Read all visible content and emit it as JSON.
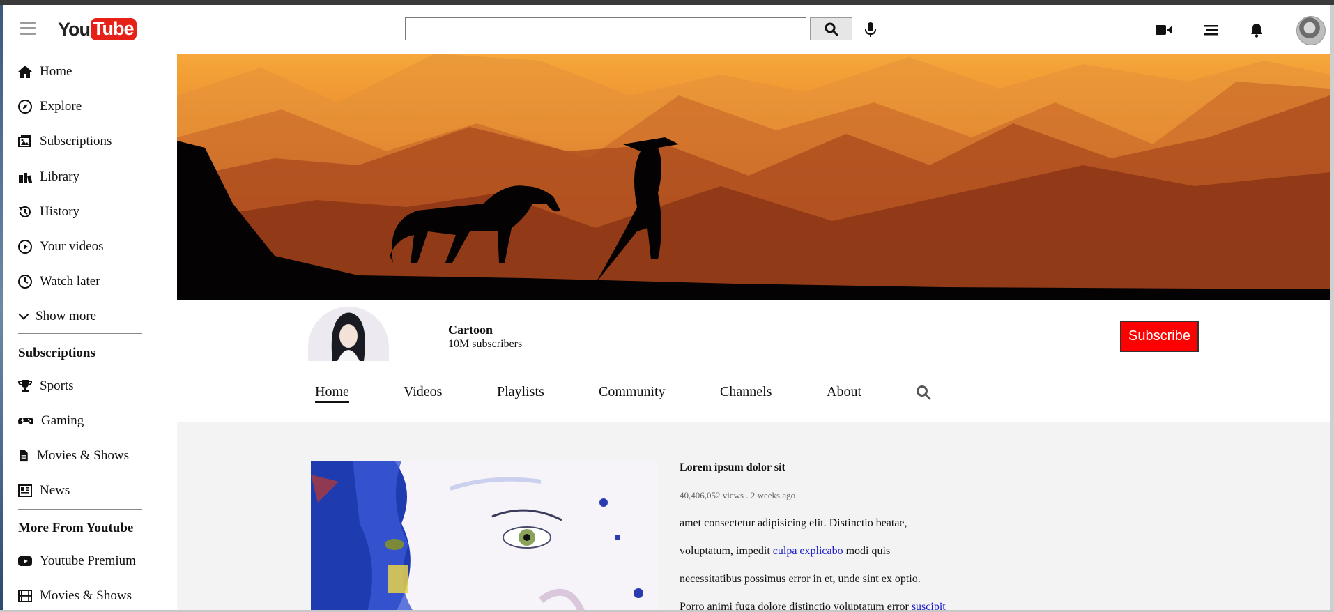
{
  "header": {
    "logo_you": "You",
    "logo_tube": "Tube",
    "search_placeholder": "",
    "icons": [
      "hamburger-icon",
      "search-icon",
      "mic-icon",
      "video-camera-icon",
      "apps-list-icon",
      "bell-icon"
    ]
  },
  "sidebar": {
    "items": [
      {
        "label": "Home",
        "icon": "home-icon"
      },
      {
        "label": "Explore",
        "icon": "compass-icon"
      },
      {
        "label": "Subscriptions",
        "icon": "subscriptions-icon"
      },
      {
        "label": "Library",
        "icon": "library-icon"
      },
      {
        "label": "History",
        "icon": "history-icon"
      },
      {
        "label": "Your videos",
        "icon": "play-circle-icon"
      },
      {
        "label": "Watch later",
        "icon": "clock-icon"
      },
      {
        "label": "Show more",
        "icon": "chevron-down-icon"
      }
    ],
    "subscriptions_heading": "Subscriptions",
    "subscriptions": [
      {
        "label": "Sports",
        "icon": "trophy-icon"
      },
      {
        "label": "Gaming",
        "icon": "gamepad-icon"
      },
      {
        "label": "Movies & Shows",
        "icon": "file-icon"
      },
      {
        "label": "News",
        "icon": "newspaper-icon"
      }
    ],
    "more_heading": "More From Youtube",
    "more": [
      {
        "label": "Youtube Premium",
        "icon": "youtube-icon"
      },
      {
        "label": "Movies & Shows",
        "icon": "film-icon"
      }
    ]
  },
  "channel": {
    "name": "Cartoon",
    "subscribers": "10M subscribers",
    "subscribe_label": "Subscribe",
    "tabs": [
      "Home",
      "Videos",
      "Playlists",
      "Community",
      "Channels",
      "About"
    ],
    "active_tab": "Home"
  },
  "video": {
    "title": "Lorem ipsum dolor sit",
    "meta": "40,406,052 views . 2 weeks ago",
    "line1": "amet consectetur adipisicing elit. Distinctio beatae,",
    "line2_pre": "voluptatum, impedit ",
    "line2_link": "culpa explicabo",
    "line2_post": " modi quis",
    "line3": "necessitatibus possimus error in et, unde sint ex optio.",
    "line4_pre": "Porro animi fuga dolore distinctio voluptatum error ",
    "line4_link": "suscipit"
  },
  "colors": {
    "brand_red": "#ff0000",
    "link_blue": "#1a1acc",
    "content_bg": "#f3f3f3"
  }
}
